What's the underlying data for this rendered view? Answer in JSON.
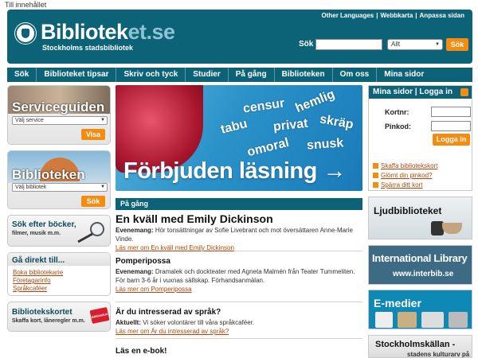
{
  "skip_link": "Till innehållet",
  "header": {
    "logo_main": "Bibliotek",
    "logo_accent": "et.se",
    "logo_sub": "Stockholms stadsbibliotek",
    "top_links": [
      "Other Languages",
      "Webbkarta",
      "Anpassa sidan"
    ],
    "search_label": "Sök",
    "search_value": "",
    "search_scope": "Allt",
    "search_button": "Sök"
  },
  "nav": [
    "Sök",
    "Biblioteket tipsar",
    "Skriv och tyck",
    "Studier",
    "På gång",
    "Biblioteken",
    "Om oss",
    "Mina sidor"
  ],
  "left": {
    "serviceguiden": {
      "title": "Serviceguiden",
      "select": "Välj service",
      "button": "Visa"
    },
    "biblioteken": {
      "title": "Biblioteken",
      "select": "Välj bibliotek",
      "button": "Sök"
    },
    "sok_bocker": {
      "title": "Sök efter böcker,",
      "sub": "filmer, musik m.m."
    },
    "ga_direkt": {
      "title": "Gå direkt till...",
      "links": [
        "Boka bibliotekarie",
        "Företagarinfo",
        "Språkcaféer"
      ]
    },
    "bibliotekskortet": {
      "title": "Bibliotekskortet",
      "sub": "Skaffa kort, låneregler m.m.",
      "card": "Biblioteket"
    }
  },
  "banner": {
    "words": [
      "censur",
      "hemlig",
      "tabu",
      "privat",
      "skräp",
      "omoral",
      "snusk"
    ],
    "headline": "Förbjuden läsning →"
  },
  "pagang": {
    "heading": "På gång",
    "items": [
      {
        "title": "En kväll med Emily Dickinson",
        "label": "Evenemang:",
        "text": "Hör tonsättningar av Sofie Livebrant och mot översättaren Anne-Marie Vinde.",
        "link": "Läs mer om En kväll med Emily Dickinson"
      },
      {
        "title": "Pomperipossa",
        "label": "Evenemang:",
        "text": "Dramalek och dockteater med Agneta Malmén från Teater Tummeliten. För barn 3-6 år i vuxnas sällskap. Förhandsanmälan.",
        "link": "Läs mer om Pomperipossa"
      },
      {
        "title": "Är du intresserad av språk?",
        "label": "Aktuellt:",
        "text": "Vi söker volontärer till våra språkcaféer.",
        "link": "Läs mer om Är du intresserad av språk?"
      },
      {
        "title": "Läs en e-bok!",
        "label": "",
        "text": "",
        "link": ""
      }
    ]
  },
  "login": {
    "title": "Mina sidor | Logga in",
    "card_label": "Kortnr:",
    "pin_label": "Pinkod:",
    "button": "Logga in",
    "links": [
      "Skaffa bibliotekskort",
      "Glömt din pinkod?",
      "Spärra ditt kort"
    ]
  },
  "promos": {
    "ljud": "Ljudbiblioteket",
    "intl_title": "International Library",
    "intl_url": "www.interbib.se",
    "emedier": "E-medier",
    "stk_title": "Stockholmskällan -",
    "stk_sub": "stadens kulturarv på nätet"
  }
}
